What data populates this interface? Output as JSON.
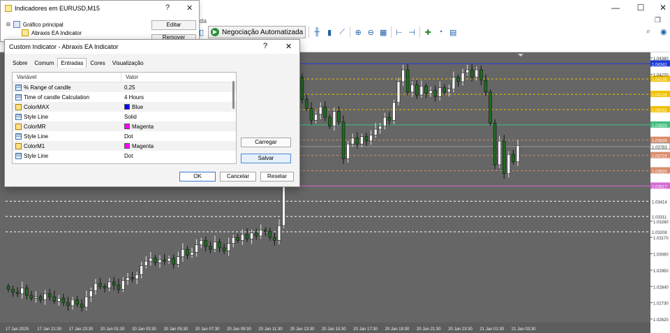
{
  "window": {
    "minimize_glyph": "—",
    "maximize_glyph": "☐",
    "close_glyph": "✕",
    "restore_glyph": "❐",
    "title_fragment": "da"
  },
  "toolbar": {
    "algo_trading_label": "Negociação Automatizada",
    "icons": [
      "new-order-icon",
      "algo-icon",
      "bar-chart-icon",
      "candles-icon",
      "line-chart-icon",
      "zoom-in-icon",
      "zoom-out-icon",
      "tile-icon",
      "scroll-icon",
      "shift-icon",
      "indicators-icon",
      "periods-icon",
      "templates-icon"
    ],
    "right_icons": [
      "search-icon",
      "profile-icon"
    ]
  },
  "navigator": {
    "title": "Indicadores em EURUSD,M15",
    "help": "?",
    "close": "✕",
    "tree": [
      {
        "label": "Gráfico principal",
        "icon": "chart-window-icon"
      },
      {
        "label": "Abraxis EA Indicator",
        "icon": "indicator-icon"
      }
    ],
    "edit_label": "Editar",
    "remove_label": "Remover"
  },
  "dialog": {
    "title": "Custom Indicator - Abraxis EA Indicator",
    "help": "?",
    "close": "✕",
    "tabs": [
      "Sobre",
      "Comum",
      "Entradas",
      "Cores",
      "Visualização"
    ],
    "active_tab": "Entradas",
    "columns": [
      "Variável",
      "Valor"
    ],
    "rows": [
      {
        "icon": "number-param-icon",
        "name": "% Range of candle",
        "value": "0.25",
        "color": ""
      },
      {
        "icon": "number-param-icon",
        "name": "Time of candle Calculation",
        "value": "4 Hours",
        "color": ""
      },
      {
        "icon": "color-param-icon",
        "name": "ColorMAX",
        "value": "Blue",
        "color": "#0000ff"
      },
      {
        "icon": "number-param-icon",
        "name": "Style Line",
        "value": "Solid",
        "color": ""
      },
      {
        "icon": "color-param-icon",
        "name": "ColorMR",
        "value": "Magenta",
        "color": "#ff00ff"
      },
      {
        "icon": "number-param-icon",
        "name": "Style Line",
        "value": "Dot",
        "color": ""
      },
      {
        "icon": "color-param-icon",
        "name": "ColorM1",
        "value": "Magenta",
        "color": "#ff00ff"
      },
      {
        "icon": "number-param-icon",
        "name": "Style Line",
        "value": "Dot",
        "color": ""
      }
    ],
    "load_label": "Carregar",
    "save_label": "Salvar",
    "ok_label": "OK",
    "cancel_label": "Cancelar",
    "reset_label": "Resetar"
  },
  "chart_data": {
    "type": "candlestick",
    "symbol": "EURUSD",
    "timeframe": "M15",
    "ylim": [
      1.0262,
      1.0438
    ],
    "y_ticks": [
      "1.04380",
      "1.04270",
      "1.03170",
      "1.03060",
      "1.02950",
      "1.02840",
      "1.02730",
      "1.02620",
      "1.03280",
      "1.03311",
      "1.03414",
      "1.03578",
      "1.03783"
    ],
    "x_ticks": [
      "17 Jan 2025",
      "17 Jan 21:30",
      "17 Jan 23:30",
      "20 Jan 01:30",
      "20 Jan 03:30",
      "20 Jan 05:30",
      "20 Jan 07:30",
      "20 Jan 09:30",
      "20 Jan 11:30",
      "20 Jan 13:30",
      "20 Jan 15:30",
      "20 Jan 17:30",
      "20 Jan 19:30",
      "20 Jan 21:30",
      "20 Jan 23:30",
      "21 Jan 01:30",
      "21 Jan 03:30"
    ],
    "levels": [
      {
        "label": "1.04341",
        "price": 1.04341,
        "color": "#1f3bd6",
        "style": "solid"
      },
      {
        "label": "1.04238",
        "price": 1.04238,
        "color": "#f0c000",
        "style": "dash"
      },
      {
        "label": "1.04135",
        "price": 1.04135,
        "color": "#f0c000",
        "style": "dash"
      },
      {
        "label": "1.04032",
        "price": 1.04032,
        "color": "#f0c000",
        "style": "dash"
      },
      {
        "label": "1.03929",
        "price": 1.03929,
        "color": "#3fbf7f",
        "style": "solid"
      },
      {
        "label": "1.03826",
        "price": 1.03826,
        "color": "#d98c6a",
        "style": "dash"
      },
      {
        "label": "1.03723",
        "price": 1.03723,
        "color": "#d98c6a",
        "style": "dash"
      },
      {
        "label": "1.03620",
        "price": 1.0362,
        "color": "#d98c6a",
        "style": "dash"
      },
      {
        "label": "1.03517",
        "price": 1.03517,
        "color": "#d46bd4",
        "style": "solid"
      },
      {
        "label": "1.03414",
        "price": 1.03414,
        "color": "#ffffff",
        "style": "dash"
      },
      {
        "label": "1.03311",
        "price": 1.03311,
        "color": "#ffffff",
        "style": "dash"
      },
      {
        "label": "1.03208",
        "price": 1.03208,
        "color": "#ffffff",
        "style": "dash"
      }
    ],
    "current_price": "1.03783",
    "closes": [
      1.0282,
      1.028,
      1.0279,
      1.0283,
      1.0278,
      1.0276,
      1.0277,
      1.0275,
      1.0279,
      1.0277,
      1.0274,
      1.0276,
      1.0273,
      1.0271,
      1.0275,
      1.0272,
      1.027,
      1.0277,
      1.0281,
      1.0286,
      1.0284,
      1.0283,
      1.0287,
      1.0285,
      1.0282,
      1.0288,
      1.029,
      1.0289,
      1.0292,
      1.0298,
      1.0301,
      1.0303,
      1.03,
      1.0302,
      1.0301,
      1.0303,
      1.0299,
      1.0304,
      1.0309,
      1.0305,
      1.0307,
      1.0312,
      1.0315,
      1.0311,
      1.0309,
      1.0314,
      1.031,
      1.0308,
      1.0313,
      1.0317,
      1.0315,
      1.0319,
      1.0316,
      1.032,
      1.0318,
      1.0322,
      1.0321,
      1.0317,
      1.0315,
      1.0325,
      1.0368,
      1.0402,
      1.0412,
      1.0425,
      1.041,
      1.0404,
      1.0396,
      1.04,
      1.0405,
      1.0398,
      1.0392,
      1.0402,
      1.0395,
      1.037,
      1.038,
      1.0384,
      1.038,
      1.0385,
      1.0382,
      1.0386,
      1.039,
      1.0392,
      1.0398,
      1.0396,
      1.0408,
      1.0422,
      1.043,
      1.0415,
      1.042,
      1.0413,
      1.0419,
      1.0414,
      1.0416,
      1.0412,
      1.0418,
      1.0415,
      1.0417,
      1.0425,
      1.0422,
      1.0428,
      1.043,
      1.0425,
      1.043,
      1.0423,
      1.0415,
      1.0394,
      1.0366,
      1.0382,
      1.036,
      1.0373,
      1.0368,
      1.0379
    ]
  }
}
